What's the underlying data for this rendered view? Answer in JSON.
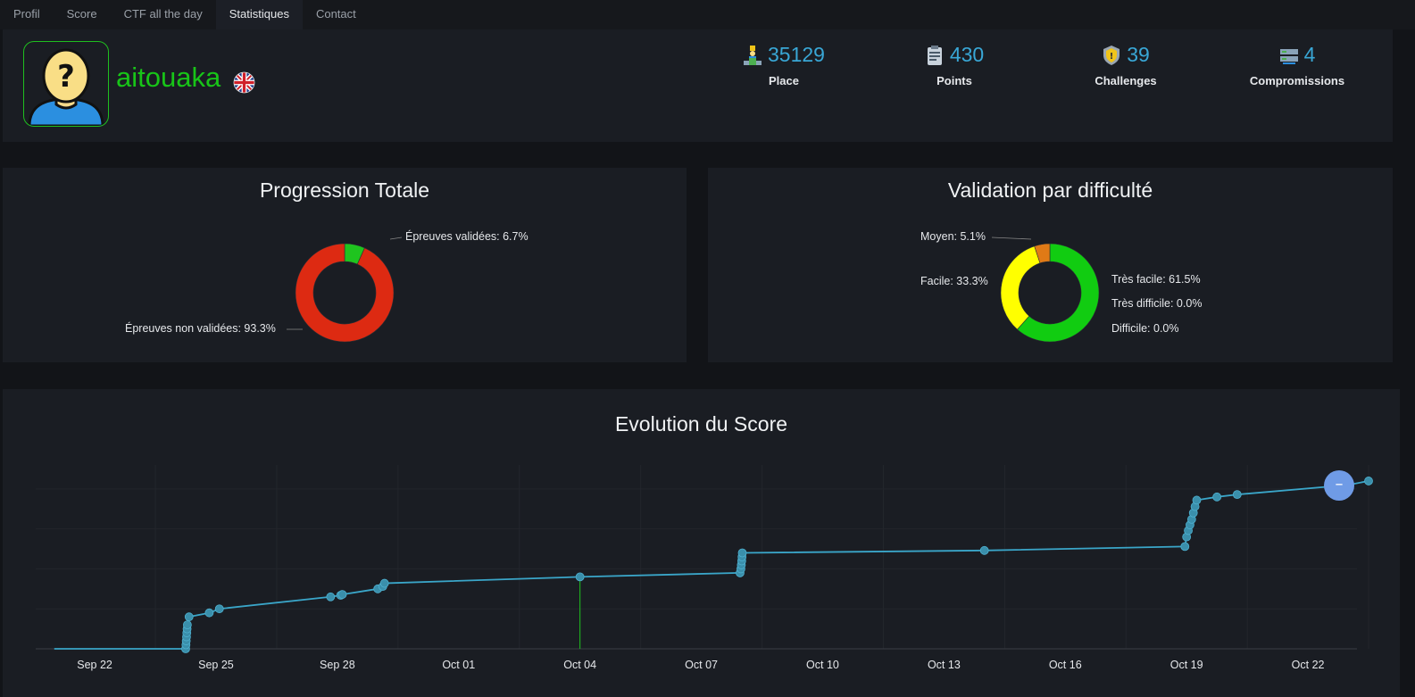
{
  "tabs": [
    {
      "label": "Profil",
      "active": false
    },
    {
      "label": "Score",
      "active": false
    },
    {
      "label": "CTF all the day",
      "active": false
    },
    {
      "label": "Statistiques",
      "active": true
    },
    {
      "label": "Contact",
      "active": false
    }
  ],
  "profile": {
    "username": "aitouaka",
    "flag": "uk-flag-icon",
    "stats": [
      {
        "value": "35129",
        "label": "Place",
        "icon": "podium-icon"
      },
      {
        "value": "430",
        "label": "Points",
        "icon": "scoreboard-icon"
      },
      {
        "value": "39",
        "label": "Challenges",
        "icon": "shield-badge-icon"
      },
      {
        "value": "4",
        "label": "Compromissions",
        "icon": "server-icon"
      }
    ]
  },
  "colors": {
    "green": "#1fc41f",
    "red": "#dd2a12",
    "yellow": "#ffff00",
    "orange": "#e07a16",
    "line": "#3aa6c9",
    "accent": "#39a7d6"
  },
  "progression": {
    "title": "Progression Totale",
    "chart_data": {
      "type": "pie",
      "labels": [
        "Épreuves validées",
        "Épreuves non validées"
      ],
      "values": [
        6.7,
        93.3
      ],
      "colors": [
        "#1fc41f",
        "#dd2a12"
      ]
    },
    "labels": [
      "Épreuves validées: 6.7%",
      "Épreuves non validées: 93.3%"
    ]
  },
  "difficulty": {
    "title": "Validation par difficulté",
    "chart_data": {
      "type": "pie",
      "labels": [
        "Très facile",
        "Facile",
        "Moyen",
        "Difficile",
        "Très difficile"
      ],
      "values": [
        61.5,
        33.3,
        5.1,
        0.0,
        0.0
      ],
      "colors": [
        "#11cc11",
        "#ffff00",
        "#e07a16",
        "#c21f1f",
        "#7b1fa2"
      ]
    },
    "labels": {
      "moyen": "Moyen: 5.1%",
      "facile": "Facile: 33.3%",
      "tres_facile": "Très facile: 61.5%",
      "tres_difficile": "Très difficile: 0.0%",
      "difficile": "Difficile: 0.0%"
    }
  },
  "evolution": {
    "title": "Evolution du Score",
    "zoom_icon": "zoom-out-icon",
    "chart_data": {
      "type": "line",
      "x_ticks": [
        "Sep 22",
        "Sep 25",
        "Sep 28",
        "Oct 01",
        "Oct 04",
        "Oct 07",
        "Oct 10",
        "Oct 13",
        "Oct 16",
        "Oct 19",
        "Oct 22"
      ],
      "points": [
        [
          "2024-09-21 00:00",
          0
        ],
        [
          "2024-09-24 06:00",
          0
        ],
        [
          "2024-09-24 06:10",
          5
        ],
        [
          "2024-09-24 06:20",
          10
        ],
        [
          "2024-09-24 06:30",
          15
        ],
        [
          "2024-09-24 06:40",
          20
        ],
        [
          "2024-09-24 06:50",
          25
        ],
        [
          "2024-09-24 07:00",
          30
        ],
        [
          "2024-09-24 08:00",
          40
        ],
        [
          "2024-09-24 20:00",
          45
        ],
        [
          "2024-09-25 02:00",
          50
        ],
        [
          "2024-09-27 20:00",
          65
        ],
        [
          "2024-09-28 02:00",
          67
        ],
        [
          "2024-09-28 03:00",
          68
        ],
        [
          "2024-09-29 00:00",
          75
        ],
        [
          "2024-09-29 03:00",
          78
        ],
        [
          "2024-09-29 04:00",
          82
        ],
        [
          "2024-10-04 00:00",
          90
        ],
        [
          "2024-10-07 23:00",
          95
        ],
        [
          "2024-10-07 23:30",
          100
        ],
        [
          "2024-10-07 23:45",
          105
        ],
        [
          "2024-10-08 00:00",
          110
        ],
        [
          "2024-10-08 00:10",
          115
        ],
        [
          "2024-10-08 00:20",
          120
        ],
        [
          "2024-10-14 00:00",
          123
        ],
        [
          "2024-10-18 23:00",
          128
        ],
        [
          "2024-10-19 00:00",
          140
        ],
        [
          "2024-10-19 01:00",
          148
        ],
        [
          "2024-10-19 02:00",
          155
        ],
        [
          "2024-10-19 03:00",
          162
        ],
        [
          "2024-10-19 04:00",
          170
        ],
        [
          "2024-10-19 05:00",
          178
        ],
        [
          "2024-10-19 06:00",
          186
        ],
        [
          "2024-10-19 18:00",
          190
        ],
        [
          "2024-10-20 06:00",
          193
        ],
        [
          "2024-10-23 00:00",
          205
        ],
        [
          "2024-10-23 12:00",
          210
        ]
      ]
    }
  }
}
